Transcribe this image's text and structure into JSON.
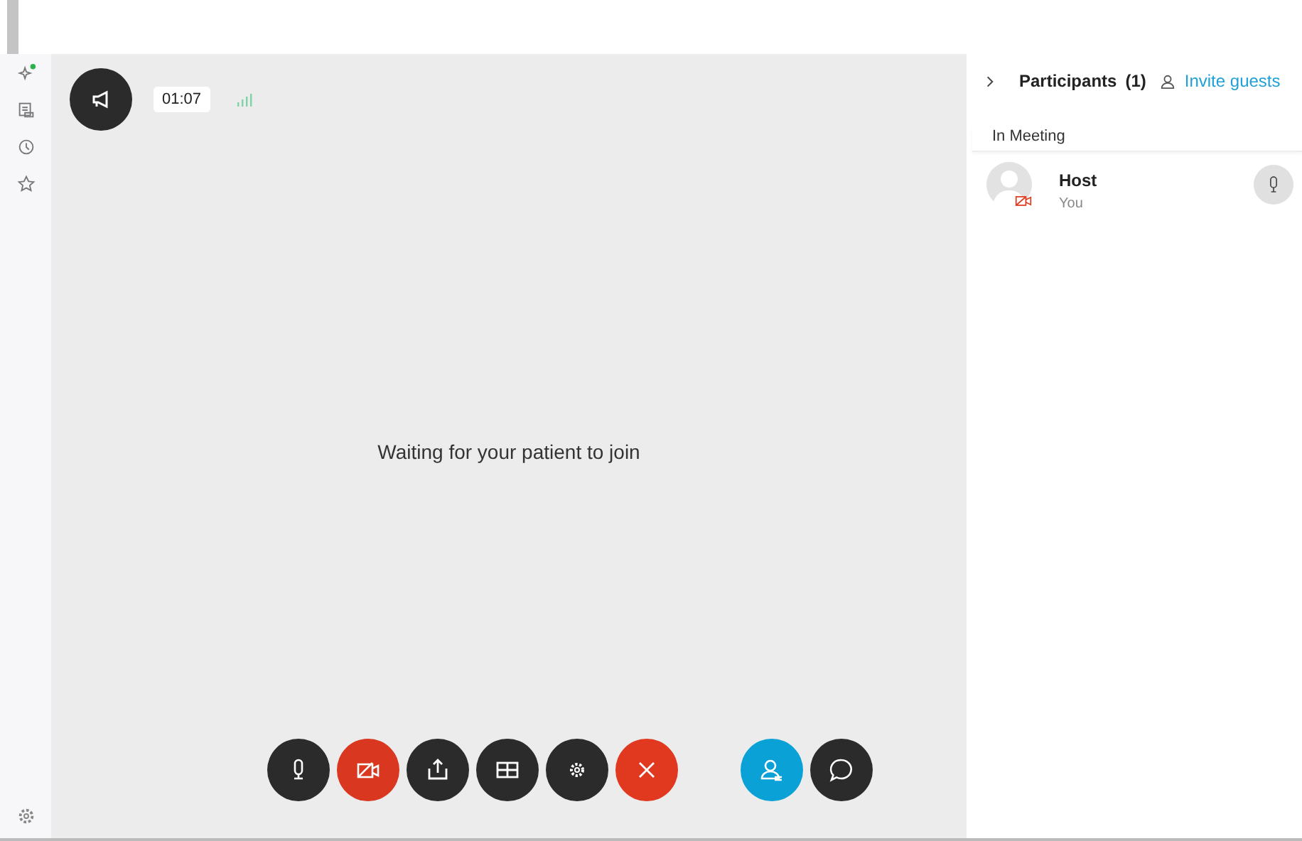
{
  "timer": "01:07",
  "message": "Waiting for your patient to join",
  "controls": [
    {
      "kind": "mic",
      "color": "#2b2b2b"
    },
    {
      "kind": "video",
      "color": "#d9371f"
    },
    {
      "kind": "share",
      "color": "#2b2b2b"
    },
    {
      "kind": "layout",
      "color": "#2b2b2b"
    },
    {
      "kind": "settings",
      "color": "#2b2b2b"
    },
    {
      "kind": "leave",
      "color": "#e0391f"
    },
    {
      "kind": "participants",
      "color": "#0aa2d6"
    },
    {
      "kind": "chat",
      "color": "#2b2b2b"
    }
  ],
  "panel": {
    "title": "Participants",
    "count": "(1)",
    "invite": "Invite guests",
    "section": "In Meeting",
    "participants": [
      {
        "name": "Host",
        "role": "You",
        "video_off": true
      }
    ]
  }
}
